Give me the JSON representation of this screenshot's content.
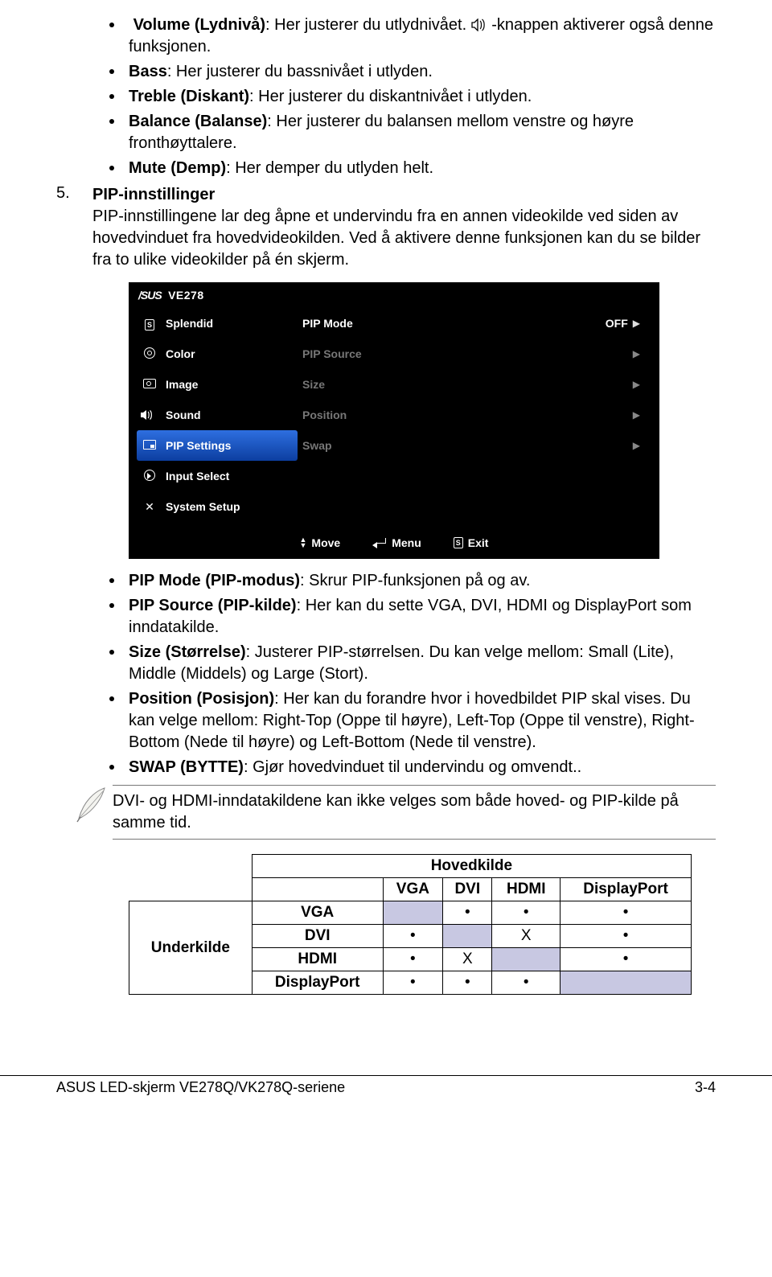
{
  "top_bullets": [
    {
      "bold": "Volume (Lydnivå)",
      "rest": ": Her justerer du utlydnivået.",
      "tail": " -knappen aktiverer også denne funksjonen.",
      "has_icon": true
    },
    {
      "bold": "Bass",
      "rest": ": Her justerer du bassnivået i utlyden."
    },
    {
      "bold": "Treble (Diskant)",
      "rest": ": Her justerer du diskantnivået i utlyden."
    },
    {
      "bold": "Balance (Balanse)",
      "rest": ": Her justerer du balansen mellom venstre og høyre fronthøyttalere."
    },
    {
      "bold": "Mute (Demp)",
      "rest": ": Her demper du utlyden helt."
    }
  ],
  "section": {
    "num": "5.",
    "title": "PIP-innstillinger",
    "para": "PIP-innstillingene lar deg åpne et undervindu fra en annen videokilde ved siden av hovedvinduet fra hovedvideokilden. Ved å aktivere denne funksjonen kan du se bilder fra to ulike videokilder på én skjerm."
  },
  "osd": {
    "model": "VE278",
    "menu": [
      "Splendid",
      "Color",
      "Image",
      "Sound",
      "PIP Settings",
      "Input Select",
      "System Setup"
    ],
    "selected_index": 4,
    "options": [
      {
        "label": "PIP Mode",
        "value": "OFF",
        "enabled": true
      },
      {
        "label": "PIP Source",
        "value": "",
        "enabled": false
      },
      {
        "label": "Size",
        "value": "",
        "enabled": false
      },
      {
        "label": "Position",
        "value": "",
        "enabled": false
      },
      {
        "label": "Swap",
        "value": "",
        "enabled": false
      }
    ],
    "footer": {
      "move": "Move",
      "menu": "Menu",
      "exit": "Exit"
    }
  },
  "pip_bullets": [
    {
      "bold": "PIP Mode (PIP-modus)",
      "rest": ": Skrur PIP-funksjonen på og av."
    },
    {
      "bold": "PIP Source (PIP-kilde)",
      "rest": ": Her kan du sette VGA, DVI, HDMI og DisplayPort som inndatakilde."
    },
    {
      "bold": "Size (Størrelse)",
      "rest": ": Justerer PIP-størrelsen. Du kan velge mellom: Small (Lite), Middle (Middels) og Large (Stort)."
    },
    {
      "bold": "Position (Posisjon)",
      "rest": ": Her kan du forandre hvor i hovedbildet PIP skal vises. Du kan velge mellom: Right-Top (Oppe til høyre), Left-Top (Oppe til venstre), Right-Bottom (Nede til høyre) og Left-Bottom (Nede til venstre)."
    },
    {
      "bold": "SWAP (BYTTE)",
      "rest": ": Gjør hovedvinduet til undervindu og omvendt.."
    }
  ],
  "note": "DVI- og HDMI-inndatakildene kan ikke velges som både hoved- og PIP-kilde på samme tid.",
  "matrix": {
    "header_top": "Hovedkilde",
    "row_header": "Underkilde",
    "cols": [
      "VGA",
      "DVI",
      "HDMI",
      "DisplayPort"
    ],
    "rows": [
      {
        "name": "VGA",
        "cells": [
          "shade",
          "•",
          "•",
          "•"
        ]
      },
      {
        "name": "DVI",
        "cells": [
          "•",
          "shade",
          "X",
          "•"
        ]
      },
      {
        "name": "HDMI",
        "cells": [
          "•",
          "X",
          "shade",
          "•"
        ]
      },
      {
        "name": "DisplayPort",
        "cells": [
          "•",
          "•",
          "•",
          "shade"
        ]
      }
    ]
  },
  "footer": {
    "left": "ASUS LED-skjerm VE278Q/VK278Q-seriene",
    "right": "3-4"
  }
}
